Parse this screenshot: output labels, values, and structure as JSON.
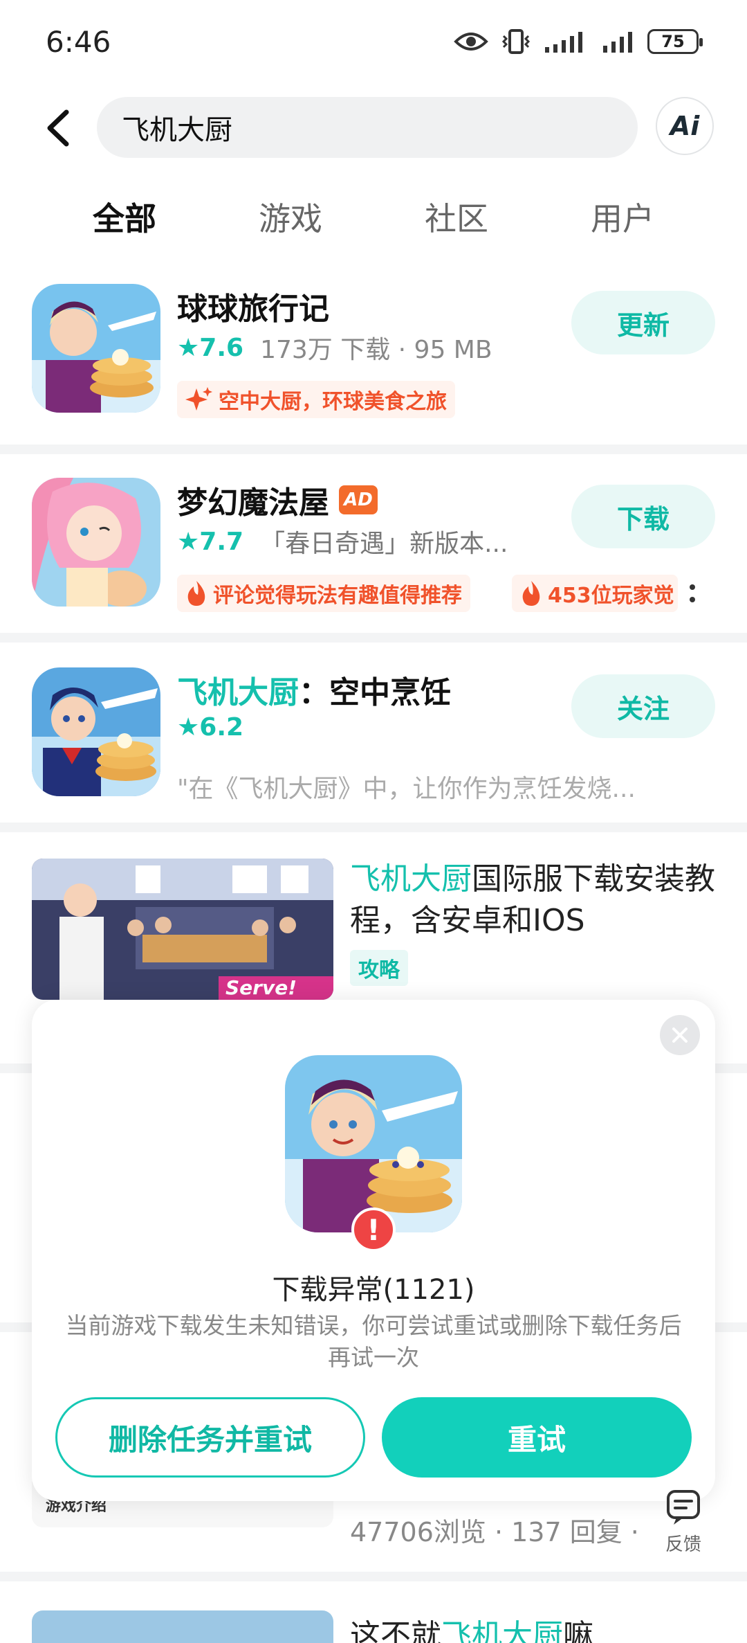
{
  "status_bar": {
    "time": "6:46",
    "battery": "75"
  },
  "search": {
    "query": "飞机大厨",
    "ai_label": "Ai"
  },
  "tabs": [
    {
      "label": "全部",
      "active": true
    },
    {
      "label": "游戏",
      "active": false
    },
    {
      "label": "社区",
      "active": false
    },
    {
      "label": "用户",
      "active": false
    }
  ],
  "results": [
    {
      "name": "球球旅行记",
      "rating": "7.6",
      "meta": "173万 下载 · 95 MB",
      "button": "更新",
      "tag": "空中大厨，环球美食之旅"
    },
    {
      "name": "梦幻魔法屋",
      "badge": "AD",
      "rating": "7.7",
      "meta": "「春日奇遇」新版本...",
      "button": "下载",
      "tag1": "评论觉得玩法有趣值得推荐",
      "tag2": "453位玩家觉"
    },
    {
      "name_highlight": "飞机大厨",
      "name_rest": "：空中烹饪",
      "rating": "6.2",
      "meta": "\"在《飞机大厨》中，让你作为烹饪发烧...",
      "button": "关注"
    }
  ],
  "article": {
    "title_highlight": "飞机大厨",
    "title_rest": "国际服下载安装教程，含安卓和IOS",
    "tag": "攻略",
    "thumb_text": "Serve!"
  },
  "dialog": {
    "title": "下载异常(1121)",
    "message": "当前游戏下载发生未知错误，你可尝试重试或删除下载任务后再试一次",
    "secondary_button": "删除任务并重试",
    "primary_button": "重试"
  },
  "behind_dialog": {
    "thumb_label": "游戏介绍",
    "stats": "47706浏览 · 137 回复 ·"
  },
  "feedback": {
    "label": "反馈"
  },
  "bottom_item": {
    "title_prefix": "这不就",
    "title_highlight": "飞机大厨",
    "title_suffix": "嘛"
  },
  "colors": {
    "accent": "#15c0ad",
    "ad": "#f36b2b",
    "error": "#ee4444",
    "tag_text": "#f0522b"
  }
}
